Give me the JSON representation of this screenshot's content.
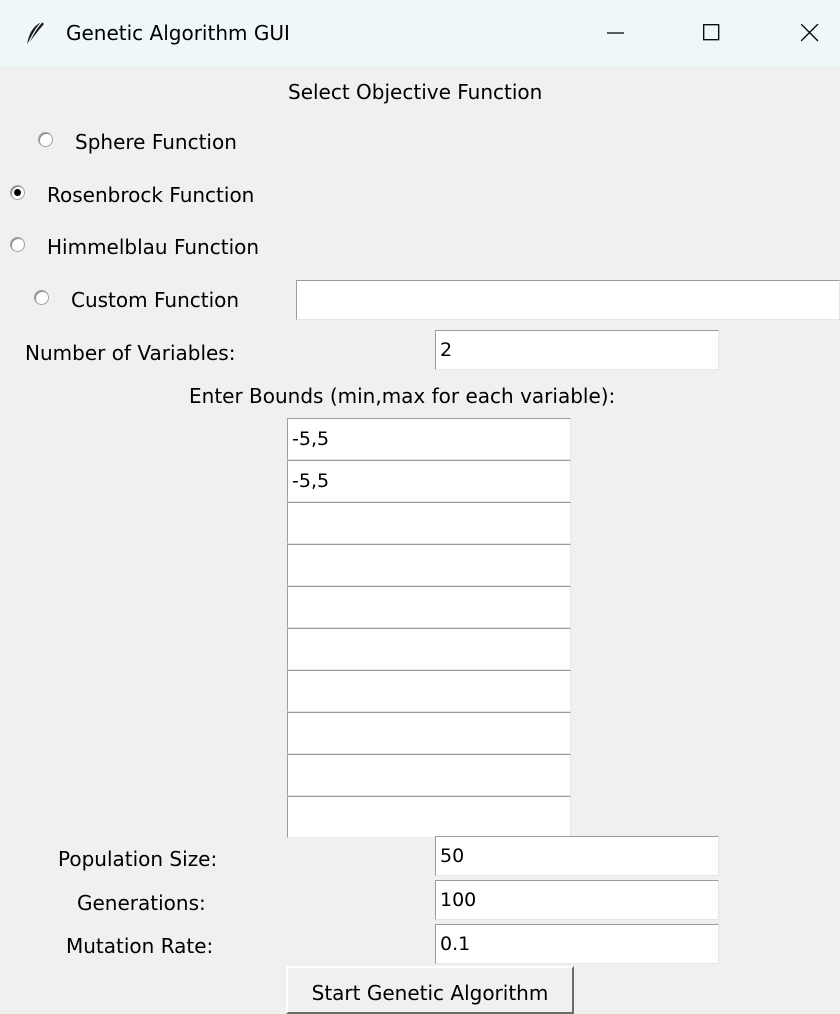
{
  "window": {
    "title": "Genetic Algorithm GUI",
    "icon": "feather-icon",
    "controls": [
      "minimize-icon",
      "maximize-icon",
      "close-icon"
    ]
  },
  "objective": {
    "heading": "Select Objective Function",
    "options": [
      {
        "label": "Sphere Function",
        "selected": false
      },
      {
        "label": "Rosenbrock Function",
        "selected": true
      },
      {
        "label": "Himmelblau Function",
        "selected": false
      },
      {
        "label": "Custom Function",
        "selected": false
      }
    ],
    "custom_value": ""
  },
  "variables": {
    "label": "Number of Variables:",
    "value": "2"
  },
  "bounds": {
    "label": "Enter Bounds (min,max for each variable):",
    "values": [
      "-5,5",
      "-5,5",
      "",
      "",
      "",
      "",
      "",
      "",
      "",
      ""
    ]
  },
  "params": {
    "population_label": "Population Size:",
    "population_value": "50",
    "generations_label": "Generations:",
    "generations_value": "100",
    "mutation_label": "Mutation Rate:",
    "mutation_value": "0.1"
  },
  "start_button": "Start Genetic Algorithm"
}
